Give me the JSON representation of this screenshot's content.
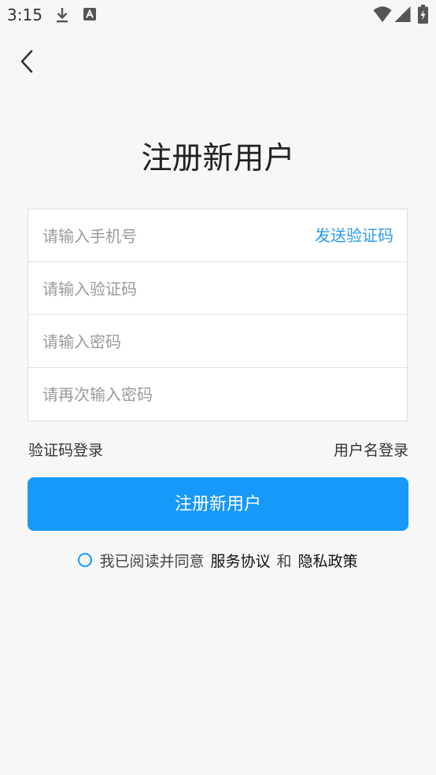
{
  "status_bar": {
    "time": "3:15"
  },
  "header": {
    "title": "注册新用户"
  },
  "form": {
    "phone_placeholder": "请输入手机号",
    "send_code_label": "发送验证码",
    "code_placeholder": "请输入验证码",
    "password_placeholder": "请输入密码",
    "confirm_password_placeholder": "请再次输入密码"
  },
  "alt_login": {
    "code_login_label": "验证码登录",
    "username_login_label": "用户名登录"
  },
  "register_button_label": "注册新用户",
  "agreement": {
    "prefix": "我已阅读并同意",
    "service_link": "服务协议",
    "and": "和",
    "privacy_link": "隐私政策"
  },
  "colors": {
    "accent": "#1699f8",
    "link": "#2a9bf0",
    "background": "#f7f7f7"
  },
  "icons": {
    "download": "download-icon",
    "notification": "app-notification-icon",
    "wifi": "wifi-icon",
    "signal": "signal-icon",
    "battery": "battery-charging-icon",
    "back": "back-arrow-icon"
  }
}
